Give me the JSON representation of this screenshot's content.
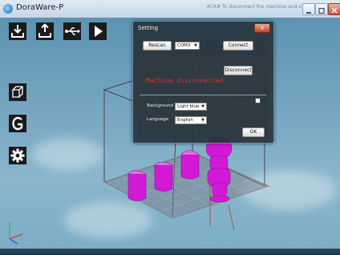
{
  "window": {
    "title": "DoraWare-P",
    "hint": "ACK# To disconnect the machine and software, click in Settings",
    "controls": [
      "minimize",
      "maximize",
      "close"
    ]
  },
  "toolbar": {
    "top_icons": [
      "import-model-icon",
      "export-model-icon",
      "usb-icon",
      "play-icon"
    ],
    "side_icons": [
      "view-cube-icon",
      "gcode-icon",
      "settings-gear-icon"
    ]
  },
  "dialog": {
    "title": "Setting",
    "close_label": "x",
    "rescan_label": "Rescan",
    "port_value": "COM3",
    "connect_label": "Connect",
    "status_text": "Machine disconnected",
    "disconnect_label": "Disconnect",
    "background_label": "Background",
    "background_value": "Light blue",
    "language_label": "Language",
    "language_value": "English",
    "ok_label": "OK"
  },
  "colors": {
    "model": "#d21ad6",
    "status": "#e0302a",
    "background": "#6e9fb8"
  }
}
